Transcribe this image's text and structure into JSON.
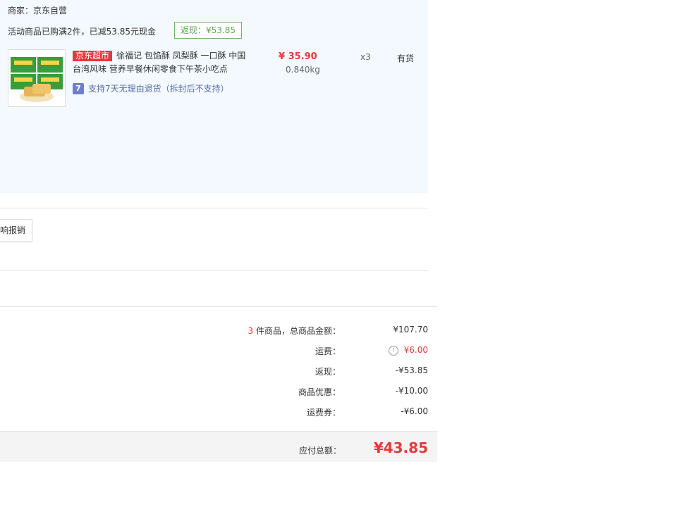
{
  "order": {
    "merchant_label": "商家：京东自营",
    "promo_text": "活动商品已购满2件，已减53.85元现金",
    "cashback_tag": "返现：¥53.85",
    "product": {
      "badge": "京东超市",
      "title": "徐福记 包馅酥 凤梨酥 一口酥 中国台湾风味 营养早餐休闲零食下午茶小吃点",
      "return_icon": "7",
      "return_policy": "支持7天无理由退货（拆封后不支持）",
      "price": "¥ 35.90",
      "weight": "0.840kg",
      "quantity": "x3",
      "stock": "有货"
    }
  },
  "invoice": {
    "button_label": "响报销"
  },
  "summary": {
    "item_count": "3",
    "item_count_suffix": " 件商品，总商品金额：",
    "total_goods": "¥107.70",
    "freight_label": "运费：",
    "freight_value": "¥6.00",
    "cashback_label": "返现：",
    "cashback_value": "-¥53.85",
    "discount_label": "商品优惠：",
    "discount_value": "-¥10.00",
    "freight_coupon_label": "运费券：",
    "freight_coupon_value": "-¥6.00",
    "payable_label": "应付总额：",
    "payable_value": "¥43.85"
  },
  "colors": {
    "accent_red": "#e4393c",
    "panel_bg": "#f3f9fe",
    "cashback_green": "#5aa84f",
    "link_blue": "#5a6fa8"
  }
}
